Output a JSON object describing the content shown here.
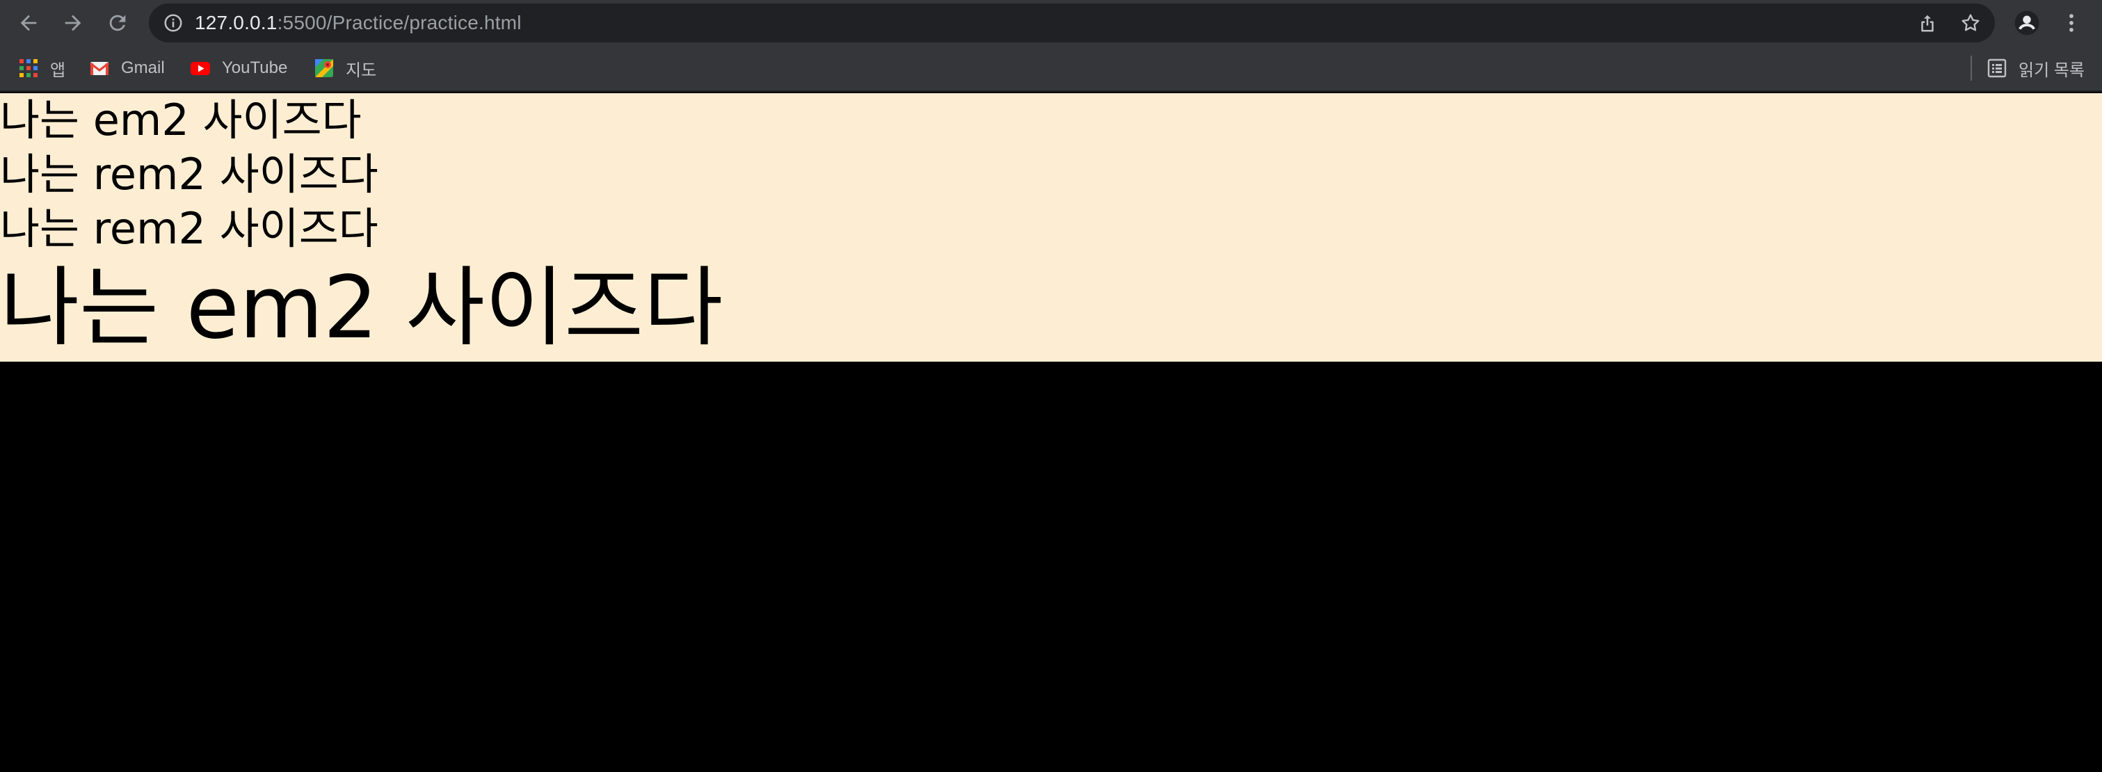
{
  "browser": {
    "url_host": "127.0.0.1",
    "url_path": ":5500/Practice/practice.html",
    "icons": {
      "back": "back-arrow-icon",
      "forward": "forward-arrow-icon",
      "reload": "reload-icon",
      "site_info": "info-icon",
      "share": "share-icon",
      "bookmark": "star-icon",
      "profile": "profile-icon",
      "menu": "kebab-menu-icon"
    }
  },
  "bookmarks": {
    "items": [
      {
        "label": "앱",
        "icon": "apps-grid-icon"
      },
      {
        "label": "Gmail",
        "icon": "gmail-icon"
      },
      {
        "label": "YouTube",
        "icon": "youtube-icon"
      },
      {
        "label": "지도",
        "icon": "maps-icon"
      }
    ],
    "reading_list": {
      "label": "읽기 목록",
      "icon": "reading-list-icon"
    }
  },
  "page": {
    "background": "#fdeed3",
    "lines": [
      "나는 em2 사이즈다",
      "나는 rem2 사이즈다",
      "나는 rem2 사이즈다",
      "나는 em2 사이즈다"
    ]
  }
}
